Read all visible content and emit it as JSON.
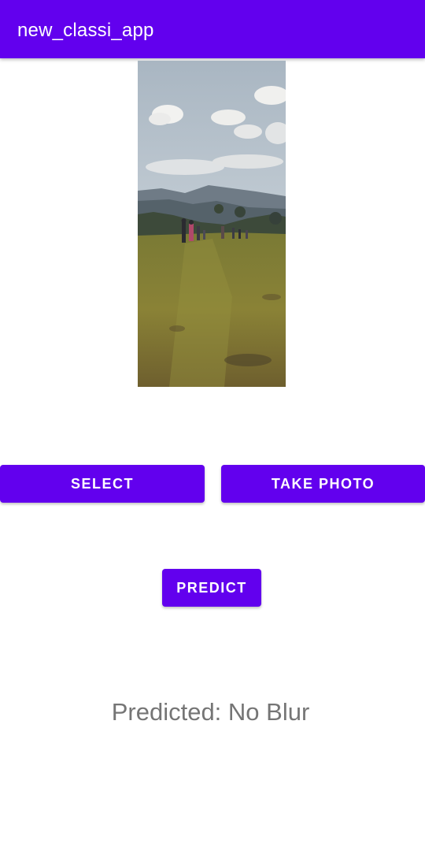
{
  "app_bar": {
    "title": "new_classi_app",
    "color": "#6200EE"
  },
  "image_preview": {
    "description_icon": "landscape-photo"
  },
  "buttons": {
    "select_label": "SELECT",
    "take_photo_label": "TAKE PHOTO",
    "predict_label": "PREDICT"
  },
  "result": {
    "text": "Predicted: No Blur"
  }
}
